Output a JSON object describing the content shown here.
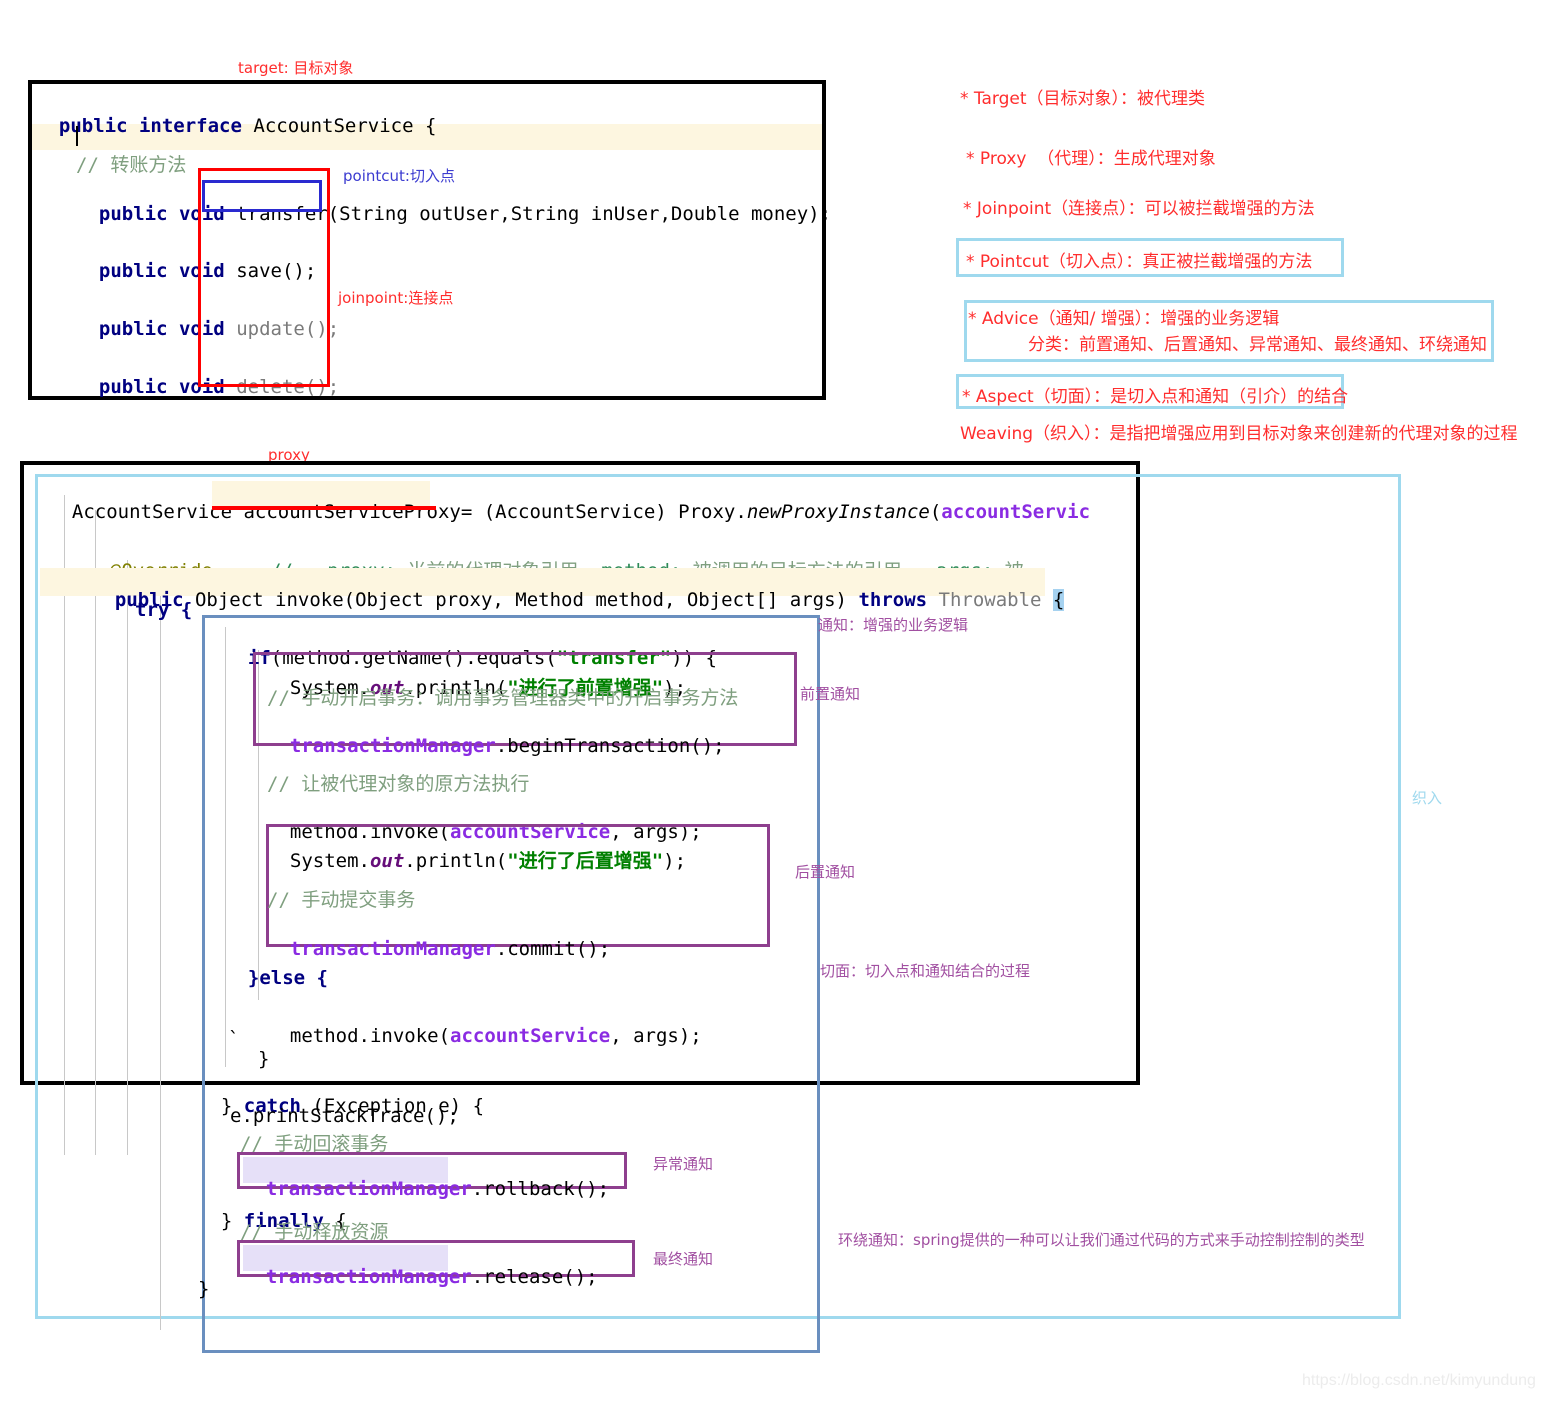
{
  "top_panel": {
    "label_target": "target: 目标对象",
    "label_pointcut": "pointcut:切入点",
    "label_joinpoint": "joinpoint:连接点",
    "code": {
      "l1_kw1": "public",
      "l1_kw2": "interface",
      "l1_name": "AccountService {",
      "l3_comment": "// 转账方法",
      "l4_kw1": "public",
      "l4_kw2": "void",
      "l4_sig": "transfer(String outUser,String inUser,Double money);",
      "l5_kw1": "public",
      "l5_kw2": "void",
      "l5_sig": "save();",
      "l6_kw1": "public",
      "l6_kw2": "void",
      "l6_sig": "update();",
      "l7_kw1": "public",
      "l7_kw2": "void",
      "l7_sig": "delete();"
    }
  },
  "glossary": {
    "items": [
      {
        "text": "* Target（目标对象）：被代理类",
        "boxed": false
      },
      {
        "text": "* Proxy  （代理）：生成代理对象",
        "boxed": false
      },
      {
        "text": "* Joinpoint（连接点）：可以被拦截增强的方法",
        "boxed": false
      },
      {
        "text": "* Pointcut（切入点）：真正被拦截增强的方法",
        "boxed": true
      },
      {
        "text": "* Advice（通知/ 增强）：增强的业务逻辑",
        "boxed": true
      },
      {
        "text": "分类：前置通知、后置通知、异常通知、最终通知、环绕通知",
        "boxed": true
      },
      {
        "text": "* Aspect（切面）：是切入点和通知（引介）的结合",
        "boxed": true
      },
      {
        "text": "Weaving（织入）：是指把增强应用到目标对象来创建新的代理对象的过程",
        "boxed": false
      }
    ]
  },
  "bottom_panel": {
    "label_proxy": "proxy",
    "label_weaving": "织入",
    "label_advice": "通知：增强的业务逻辑",
    "label_before": "前置通知",
    "label_after": "后置通知",
    "label_aspect": "切面：切入点和通知结合的过程",
    "label_throwing": "异常通知",
    "label_final": "最终通知",
    "label_around": "环绕通知：spring提供的一种可以让我们通过代码的方式来手动控制控制的类型",
    "code": {
      "line_decl_a": "AccountService ",
      "line_decl_var": "accountServiceProxy",
      "line_decl_b": "= (AccountService) Proxy.",
      "line_decl_italic": "newProxyInstance",
      "line_decl_c": "(",
      "line_decl_arg": "accountServic",
      "override": "@Override",
      "override_slashes": "//",
      "override_c1": "proxy:",
      "override_c1v": "当前的代理对象引用",
      "override_c2": "method:",
      "override_c2v": "被调用的目标方法的引用",
      "override_c3": "args:",
      "override_c3v": "被",
      "invoke_kw1": "public",
      "invoke_mid": " Object invoke(Object proxy, Method method, Object[] args) ",
      "invoke_kw2": "throws",
      "invoke_dim": " Throwable ",
      "invoke_brace": "{",
      "try": "try {",
      "if_kw": "if",
      "if_rest1": "(method.getName().equals(",
      "if_str": "\"transfer\"",
      "if_rest2": ")) {",
      "sysout_before_a": "System.",
      "sysout_before_out": "out",
      "sysout_before_b": ".println(",
      "sysout_before_str": "\"进行了前置增强\"",
      "sysout_before_c": ");",
      "cmt_begin": "// 手动开启事务：调用事务管理器类中的开启事务方法",
      "tm_begin_obj": "transactionManager",
      "tm_begin_rest": ".beginTransaction();",
      "cmt_origin": "// 让被代理对象的原方法执行",
      "invoke_call_a": "method.invoke(",
      "invoke_call_obj": "accountService",
      "invoke_call_b": ", args);",
      "sysout_after_str": "\"进行了后置增强\"",
      "cmt_commit": "// 手动提交事务",
      "tm_commit_rest": ".commit();",
      "else": "}else {",
      "close_brace": "}",
      "catch_a": "} ",
      "catch_kw": "catch",
      "catch_b": " (Exception e) {",
      "printstack": "e.printStackTrace();",
      "cmt_rollback": "// 手动回滚事务",
      "tm_rollback_rest": ".rollback();",
      "finally_a": "} ",
      "finally_kw": "finally",
      "finally_b": " {",
      "cmt_release": "// 手动释放资源",
      "tm_release_rest": ".release();",
      "tick": "`"
    }
  },
  "watermark": "https://blog.csdn.net/kimyundung"
}
